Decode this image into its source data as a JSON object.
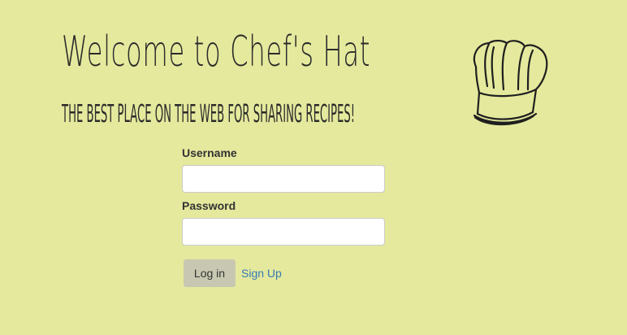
{
  "header": {
    "title": "Welcome to Chef's Hat",
    "subtitle": "The best place on the web for sharing recipes!",
    "logo_icon": "chef-hat-icon"
  },
  "login": {
    "username_label": "Username",
    "username_value": "",
    "password_label": "Password",
    "password_value": "",
    "login_button_label": "Log in",
    "signup_link_label": "Sign Up"
  },
  "colors": {
    "background": "#e5e99d",
    "text": "#333333",
    "link": "#337ab7",
    "button_background": "#c8c8b2",
    "input_border": "#cccccc"
  }
}
